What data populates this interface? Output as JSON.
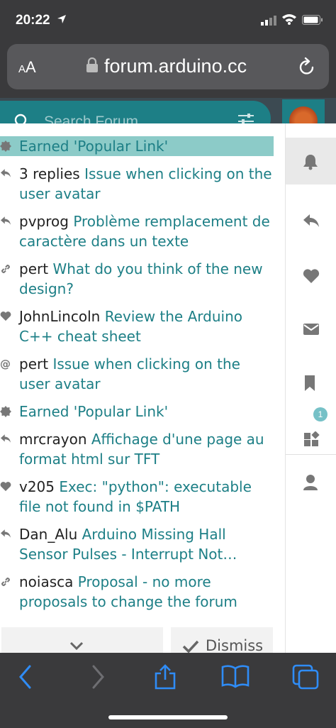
{
  "status_bar": {
    "time": "20:22"
  },
  "address_bar": {
    "aa_label_small": "A",
    "aa_label_large": "A",
    "url": "forum.arduino.cc"
  },
  "search": {
    "placeholder": "Search Forum"
  },
  "notifications": [
    {
      "type": "badge",
      "who": "",
      "topic": "Earned 'Popular Link'",
      "highlight": true
    },
    {
      "type": "reply",
      "who": "3 replies",
      "topic": "Issue when clicking on the user avatar"
    },
    {
      "type": "reply",
      "who": "pvprog",
      "topic": "Problème remplacement de caractère dans un texte"
    },
    {
      "type": "link",
      "who": "pert",
      "topic": "What do you think of the new design?"
    },
    {
      "type": "like",
      "who": "JohnLincoln",
      "topic": "Review the Arduino C++ cheat sheet"
    },
    {
      "type": "mention",
      "who": "pert",
      "topic": "Issue when clicking on the user avatar"
    },
    {
      "type": "badge",
      "who": "",
      "topic": "Earned 'Popular Link'"
    },
    {
      "type": "reply",
      "who": "mrcrayon",
      "topic": "Affichage d'une page au format html sur TFT"
    },
    {
      "type": "like",
      "who": "v205",
      "topic": "Exec: \"python\": executable file not found in $PATH"
    },
    {
      "type": "reply",
      "who": "Dan_Alu",
      "topic": "Arduino Missing Hall Sensor Pulses - Interrupt Not…"
    },
    {
      "type": "link",
      "who": "noiasca",
      "topic": "Proposal - no more proposals to change the forum"
    }
  ],
  "footer": {
    "dismiss_label": "Dismiss"
  },
  "menu": {
    "tabs": [
      "bell-icon",
      "reply-icon",
      "heart-icon",
      "envelope-icon",
      "bookmark-icon",
      "widgets-icon"
    ],
    "review_badge_count": "1"
  },
  "colors": {
    "accent": "#1d7f86",
    "highlight": "#8ccbc8",
    "chrome": "#3a3a3c",
    "toolbar_blue": "#2f8cf6"
  }
}
